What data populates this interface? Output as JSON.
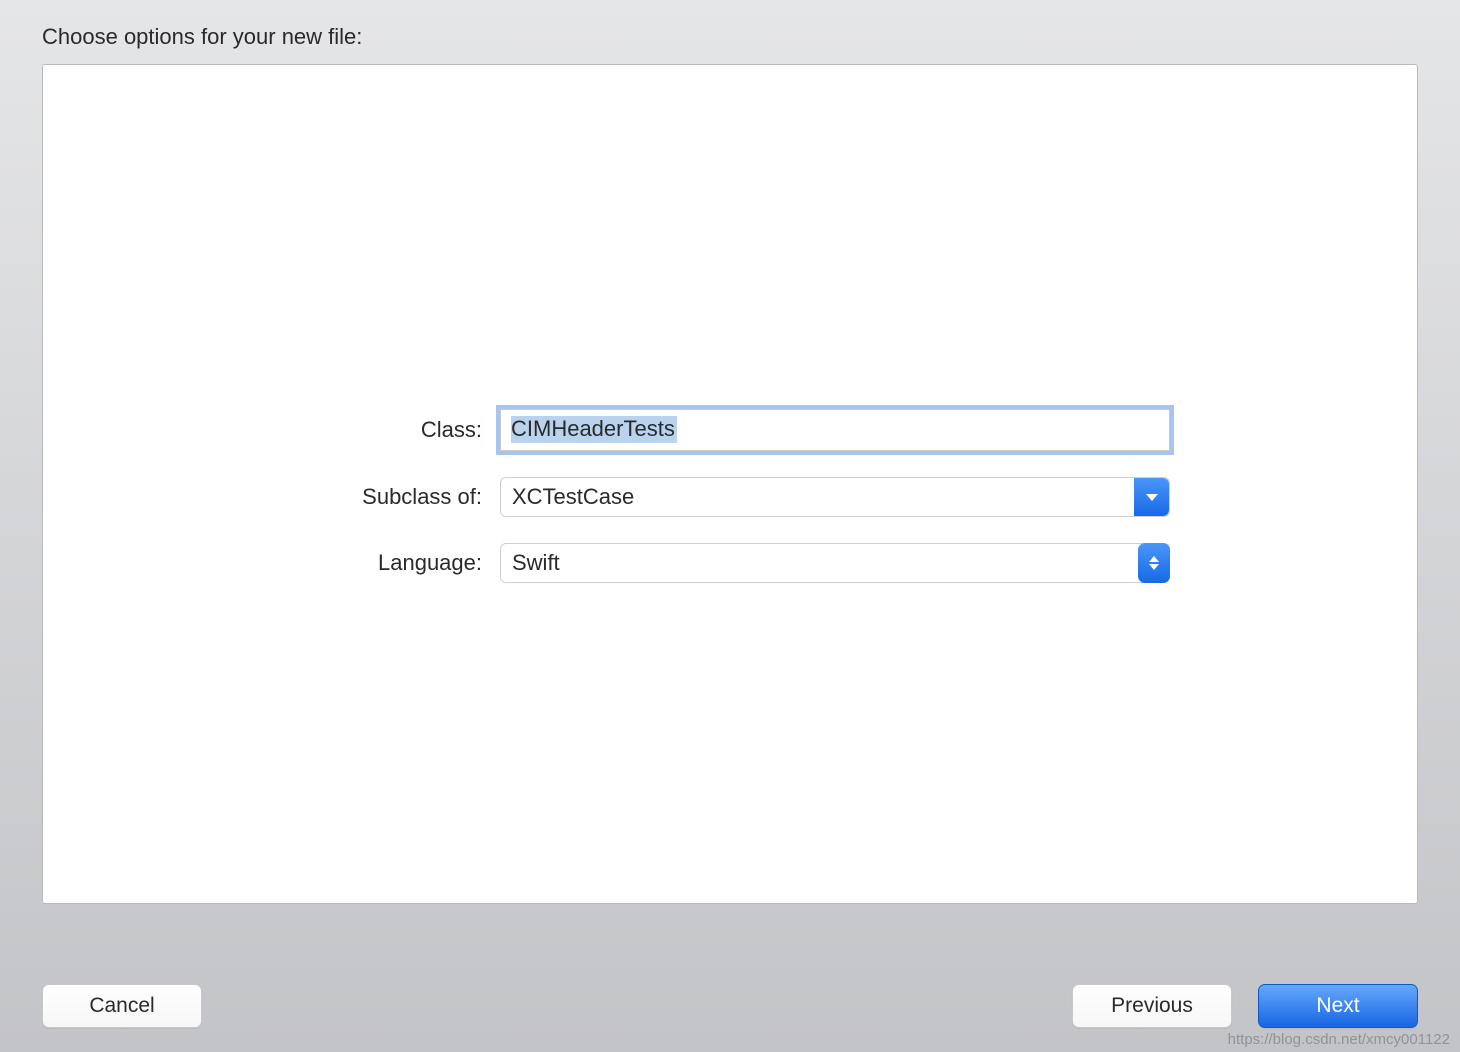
{
  "header": {
    "title": "Choose options for your new file:"
  },
  "form": {
    "class_label": "Class:",
    "class_value": "CIMHeaderTests",
    "subclass_label": "Subclass of:",
    "subclass_value": "XCTestCase",
    "language_label": "Language:",
    "language_value": "Swift"
  },
  "buttons": {
    "cancel": "Cancel",
    "previous": "Previous",
    "next": "Next"
  },
  "watermark": "https://blog.csdn.net/xmcy001122"
}
